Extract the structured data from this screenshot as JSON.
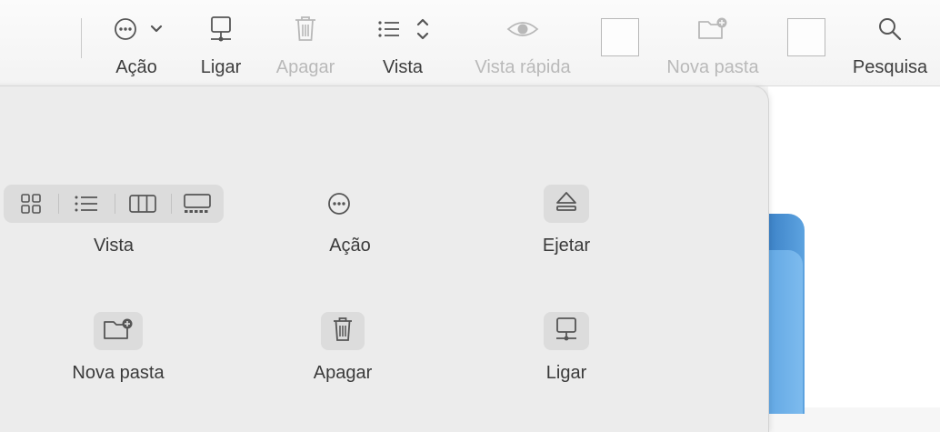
{
  "toolbar": {
    "items": [
      {
        "label": "Ação",
        "icon": "ellipsis-circle-chevron-icon",
        "enabled": true
      },
      {
        "label": "Ligar",
        "icon": "network-server-icon",
        "enabled": true
      },
      {
        "label": "Apagar",
        "icon": "trash-icon",
        "enabled": false
      },
      {
        "label": "Vista",
        "icon": "list-view-chevrons-icon",
        "enabled": true
      },
      {
        "label": "Vista rápida",
        "icon": "eye-icon",
        "enabled": false
      },
      {
        "label": "Nova pasta",
        "icon": "new-folder-icon",
        "enabled": false
      },
      {
        "label": "Pesquisa",
        "icon": "magnifier-icon",
        "enabled": true
      }
    ]
  },
  "customize_panel": {
    "items": [
      {
        "label": "Vista",
        "icon": "view-mode-segmented-icon"
      },
      {
        "label": "Ação",
        "icon": "ellipsis-circle-icon"
      },
      {
        "label": "Ejetar",
        "icon": "eject-icon"
      },
      {
        "label": "Nova pasta",
        "icon": "new-folder-icon"
      },
      {
        "label": "Apagar",
        "icon": "trash-icon"
      },
      {
        "label": "Ligar",
        "icon": "network-server-icon"
      }
    ],
    "view_modes": [
      "icon-grid-icon",
      "list-icon",
      "columns-icon",
      "gallery-icon"
    ]
  },
  "colors": {
    "toolbar_bg": "#f6f6f6",
    "panel_bg": "#ececec",
    "button_bg": "#dcdcdc",
    "disabled_text": "#b9b9b9",
    "folder_blue": "#5da3e0"
  }
}
